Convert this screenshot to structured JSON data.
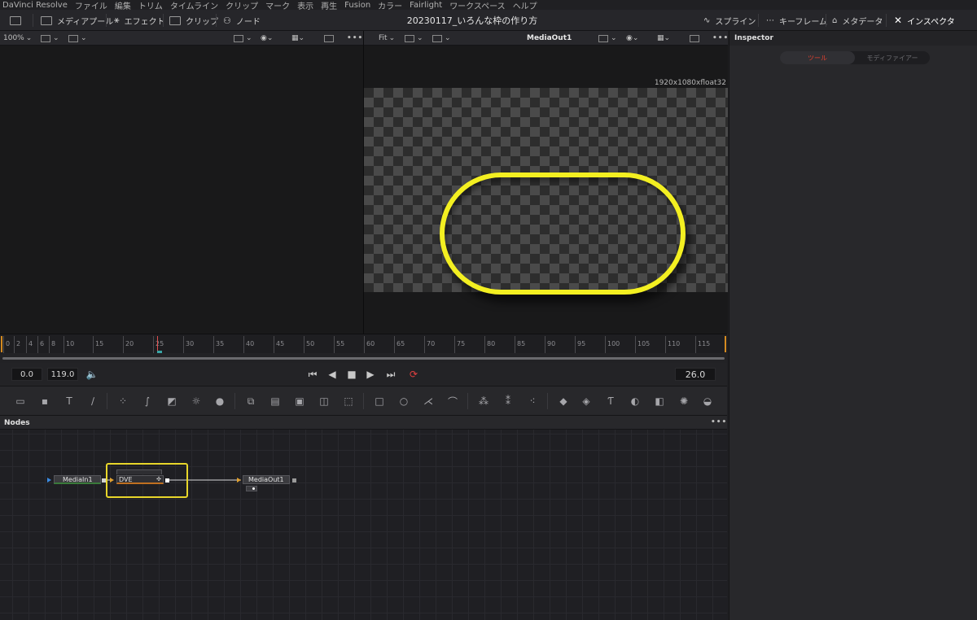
{
  "menubar": [
    "DaVinci Resolve",
    "ファイル",
    "編集",
    "トリム",
    "タイムライン",
    "クリップ",
    "マーク",
    "表示",
    "再生",
    "Fusion",
    "カラー",
    "Fairlight",
    "ワークスペース",
    "ヘルプ"
  ],
  "toolbar": {
    "media_pool": "メディアプール",
    "effects": "エフェクト",
    "clips": "クリップ",
    "nodes": "ノード",
    "title": "20230117_いろんな枠の作り方",
    "spline": "スプライン",
    "keyframes": "キーフレーム",
    "metadata": "メタデータ",
    "inspector": "インスペクタ"
  },
  "viewer_left": {
    "zoom": "100%"
  },
  "viewer_right": {
    "fit": "Fit",
    "name": "MediaOut1",
    "resolution": "1920x1080xfloat32"
  },
  "inspector": {
    "title": "Inspector",
    "tab_tools": "ツール",
    "tab_modifiers": "モディファイアー"
  },
  "timeline": {
    "ticks": [
      "0",
      "2",
      "4",
      "6",
      "8",
      "10",
      "15",
      "20",
      "25",
      "30",
      "35",
      "40",
      "45",
      "50",
      "55",
      "60",
      "65",
      "70",
      "75",
      "80",
      "85",
      "90",
      "95",
      "100",
      "105",
      "110",
      "115"
    ],
    "playhead_frame": 26
  },
  "transport": {
    "start": "0.0",
    "end": "119.0",
    "current": "26.0"
  },
  "nodes_panel": {
    "title": "Nodes",
    "nodes": [
      "MediaIn1",
      "DVE",
      "MediaOut1"
    ]
  },
  "colors": {
    "accent_red": "#e04040",
    "selection_yellow": "#e8d62a",
    "pill_yellow": "#f3ef21"
  }
}
